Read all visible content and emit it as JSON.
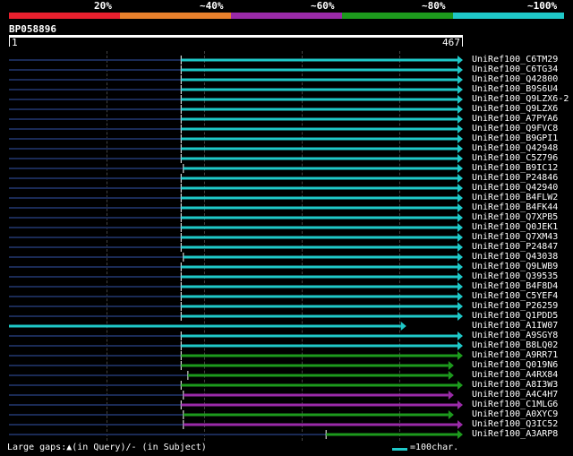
{
  "legend": {
    "labels": [
      "20%",
      "~40%",
      "~60%",
      "~80%",
      "~100%"
    ],
    "colors": [
      "#e8202e",
      "#e8802c",
      "#9a2aa8",
      "#1d9a1d",
      "#1fc8c8"
    ]
  },
  "query": {
    "id": "BP058896",
    "scale_start": "1",
    "scale_end": "467"
  },
  "hits": [
    {
      "name": "UniRef100_C6TM29",
      "start": 0.38,
      "end": 1.0,
      "color": "#1fc8c8",
      "tail": "arrow",
      "has_dark_lead": true
    },
    {
      "name": "UniRef100_C6TG34",
      "start": 0.38,
      "end": 1.0,
      "color": "#1fc8c8",
      "tail": "arrow",
      "has_dark_lead": true
    },
    {
      "name": "UniRef100_Q42800",
      "start": 0.38,
      "end": 1.0,
      "color": "#1fc8c8",
      "tail": "arrow",
      "has_dark_lead": true
    },
    {
      "name": "UniRef100_B9S6U4",
      "start": 0.38,
      "end": 1.0,
      "color": "#1fc8c8",
      "tail": "arrow",
      "has_dark_lead": true
    },
    {
      "name": "UniRef100_Q9LZX6-2",
      "start": 0.38,
      "end": 1.0,
      "color": "#1fc8c8",
      "tail": "arrow",
      "has_dark_lead": true
    },
    {
      "name": "UniRef100_Q9LZX6",
      "start": 0.38,
      "end": 1.0,
      "color": "#1fc8c8",
      "tail": "arrow",
      "has_dark_lead": true
    },
    {
      "name": "UniRef100_A7PYA6",
      "start": 0.38,
      "end": 1.0,
      "color": "#1fc8c8",
      "tail": "arrow",
      "has_dark_lead": true
    },
    {
      "name": "UniRef100_Q9FVC8",
      "start": 0.38,
      "end": 1.0,
      "color": "#1fc8c8",
      "tail": "arrow",
      "has_dark_lead": true
    },
    {
      "name": "UniRef100_B9GPI1",
      "start": 0.38,
      "end": 1.0,
      "color": "#1fc8c8",
      "tail": "arrow",
      "has_dark_lead": true
    },
    {
      "name": "UniRef100_Q42948",
      "start": 0.38,
      "end": 1.0,
      "color": "#1fc8c8",
      "tail": "arrow",
      "has_dark_lead": true
    },
    {
      "name": "UniRef100_C5Z796",
      "start": 0.38,
      "end": 1.0,
      "color": "#1fc8c8",
      "tail": "arrow",
      "has_dark_lead": true
    },
    {
      "name": "UniRef100_B9IC12",
      "start": 0.385,
      "end": 1.0,
      "color": "#1fc8c8",
      "tail": "arrow",
      "has_dark_lead": true
    },
    {
      "name": "UniRef100_P24846",
      "start": 0.38,
      "end": 1.0,
      "color": "#1fc8c8",
      "tail": "arrow",
      "has_dark_lead": true
    },
    {
      "name": "UniRef100_Q42940",
      "start": 0.38,
      "end": 1.0,
      "color": "#1fc8c8",
      "tail": "arrow",
      "has_dark_lead": true
    },
    {
      "name": "UniRef100_B4FLW2",
      "start": 0.38,
      "end": 1.0,
      "color": "#1fc8c8",
      "tail": "arrow",
      "has_dark_lead": true
    },
    {
      "name": "UniRef100_B4FK44",
      "start": 0.38,
      "end": 1.0,
      "color": "#1fc8c8",
      "tail": "arrow",
      "has_dark_lead": true
    },
    {
      "name": "UniRef100_Q7XPB5",
      "start": 0.38,
      "end": 1.0,
      "color": "#1fc8c8",
      "tail": "arrow",
      "has_dark_lead": true
    },
    {
      "name": "UniRef100_Q0JEK1",
      "start": 0.38,
      "end": 1.0,
      "color": "#1fc8c8",
      "tail": "arrow",
      "has_dark_lead": true
    },
    {
      "name": "UniRef100_Q7XM43",
      "start": 0.38,
      "end": 1.0,
      "color": "#1fc8c8",
      "tail": "arrow",
      "has_dark_lead": true
    },
    {
      "name": "UniRef100_P24847",
      "start": 0.38,
      "end": 1.0,
      "color": "#1fc8c8",
      "tail": "arrow",
      "has_dark_lead": true
    },
    {
      "name": "UniRef100_Q43038",
      "start": 0.385,
      "end": 1.0,
      "color": "#1fc8c8",
      "tail": "arrow",
      "has_dark_lead": true
    },
    {
      "name": "UniRef100_Q9LWB9",
      "start": 0.38,
      "end": 1.0,
      "color": "#1fc8c8",
      "tail": "arrow",
      "has_dark_lead": true
    },
    {
      "name": "UniRef100_Q39535",
      "start": 0.38,
      "end": 1.0,
      "color": "#1fc8c8",
      "tail": "arrow",
      "has_dark_lead": true
    },
    {
      "name": "UniRef100_B4F8D4",
      "start": 0.38,
      "end": 1.0,
      "color": "#1fc8c8",
      "tail": "arrow",
      "has_dark_lead": true
    },
    {
      "name": "UniRef100_C5YEF4",
      "start": 0.38,
      "end": 1.0,
      "color": "#1fc8c8",
      "tail": "arrow",
      "has_dark_lead": true
    },
    {
      "name": "UniRef100_P26259",
      "start": 0.38,
      "end": 1.0,
      "color": "#1fc8c8",
      "tail": "arrow",
      "has_dark_lead": true
    },
    {
      "name": "UniRef100_Q1PDD5",
      "start": 0.38,
      "end": 1.0,
      "color": "#1fc8c8",
      "tail": "arrow",
      "has_dark_lead": true
    },
    {
      "name": "UniRef100_A1IW07",
      "start": 0.0,
      "end": 0.875,
      "color": "#1fc8c8",
      "tail": "arrow",
      "has_dark_lead": false
    },
    {
      "name": "UniRef100_A9SGY8",
      "start": 0.38,
      "end": 1.0,
      "color": "#1fc8c8",
      "tail": "arrow",
      "has_dark_lead": true
    },
    {
      "name": "UniRef100_B8LQ02",
      "start": 0.38,
      "end": 1.0,
      "color": "#1fc8c8",
      "tail": "arrow",
      "has_dark_lead": true
    },
    {
      "name": "UniRef100_A9RR71",
      "start": 0.38,
      "end": 1.0,
      "color": "#1d9a1d",
      "tail": "arrow",
      "has_dark_lead": true
    },
    {
      "name": "UniRef100_Q019N6",
      "start": 0.38,
      "end": 0.98,
      "color": "#1d9a1d",
      "tail": "arrow",
      "has_dark_lead": true
    },
    {
      "name": "UniRef100_A4RX84",
      "start": 0.395,
      "end": 0.98,
      "color": "#1d9a1d",
      "tail": "arrow",
      "has_dark_lead": true
    },
    {
      "name": "UniRef100_A8I3W3",
      "start": 0.38,
      "end": 1.0,
      "color": "#1d9a1d",
      "tail": "arrow",
      "has_dark_lead": true
    },
    {
      "name": "UniRef100_A4C4H7",
      "start": 0.385,
      "end": 0.98,
      "color": "#9a2aa8",
      "tail": "arrow",
      "has_dark_lead": true
    },
    {
      "name": "UniRef100_C1MLG6",
      "start": 0.38,
      "end": 1.0,
      "color": "#9a2aa8",
      "tail": "arrow",
      "has_dark_lead": true
    },
    {
      "name": "UniRef100_A0XYC9",
      "start": 0.385,
      "end": 0.98,
      "color": "#1d9a1d",
      "tail": "arrow",
      "has_dark_lead": true
    },
    {
      "name": "UniRef100_Q3IC52",
      "start": 0.385,
      "end": 1.0,
      "color": "#9a2aa8",
      "tail": "arrow",
      "has_dark_lead": true
    },
    {
      "name": "UniRef100_A3ARP8",
      "start": 0.7,
      "end": 1.0,
      "color": "#1d9a1d",
      "tail": "arrow",
      "has_dark_lead": true
    }
  ],
  "footer": {
    "large_gaps": "Large gaps:",
    "query_marker": "▲",
    "in_query": "(in Query)/-",
    "in_subject": " (in Subject)",
    "scale_text": "=100char."
  }
}
